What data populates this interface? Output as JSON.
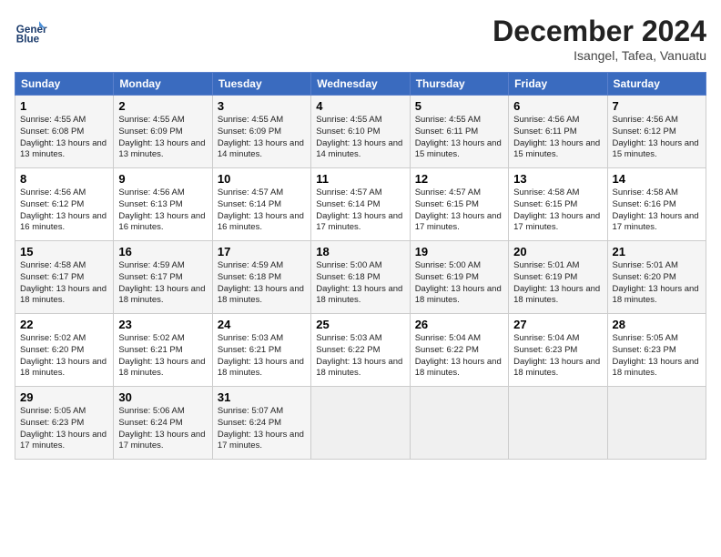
{
  "header": {
    "logo_line1": "General",
    "logo_line2": "Blue",
    "month": "December 2024",
    "location": "Isangel, Tafea, Vanuatu"
  },
  "days_of_week": [
    "Sunday",
    "Monday",
    "Tuesday",
    "Wednesday",
    "Thursday",
    "Friday",
    "Saturday"
  ],
  "weeks": [
    [
      {
        "day": 1,
        "sunrise": "4:55 AM",
        "sunset": "6:08 PM",
        "daylight": "13 hours and 13 minutes."
      },
      {
        "day": 2,
        "sunrise": "4:55 AM",
        "sunset": "6:09 PM",
        "daylight": "13 hours and 13 minutes."
      },
      {
        "day": 3,
        "sunrise": "4:55 AM",
        "sunset": "6:09 PM",
        "daylight": "13 hours and 14 minutes."
      },
      {
        "day": 4,
        "sunrise": "4:55 AM",
        "sunset": "6:10 PM",
        "daylight": "13 hours and 14 minutes."
      },
      {
        "day": 5,
        "sunrise": "4:55 AM",
        "sunset": "6:11 PM",
        "daylight": "13 hours and 15 minutes."
      },
      {
        "day": 6,
        "sunrise": "4:56 AM",
        "sunset": "6:11 PM",
        "daylight": "13 hours and 15 minutes."
      },
      {
        "day": 7,
        "sunrise": "4:56 AM",
        "sunset": "6:12 PM",
        "daylight": "13 hours and 15 minutes."
      }
    ],
    [
      {
        "day": 8,
        "sunrise": "4:56 AM",
        "sunset": "6:12 PM",
        "daylight": "13 hours and 16 minutes."
      },
      {
        "day": 9,
        "sunrise": "4:56 AM",
        "sunset": "6:13 PM",
        "daylight": "13 hours and 16 minutes."
      },
      {
        "day": 10,
        "sunrise": "4:57 AM",
        "sunset": "6:14 PM",
        "daylight": "13 hours and 16 minutes."
      },
      {
        "day": 11,
        "sunrise": "4:57 AM",
        "sunset": "6:14 PM",
        "daylight": "13 hours and 17 minutes."
      },
      {
        "day": 12,
        "sunrise": "4:57 AM",
        "sunset": "6:15 PM",
        "daylight": "13 hours and 17 minutes."
      },
      {
        "day": 13,
        "sunrise": "4:58 AM",
        "sunset": "6:15 PM",
        "daylight": "13 hours and 17 minutes."
      },
      {
        "day": 14,
        "sunrise": "4:58 AM",
        "sunset": "6:16 PM",
        "daylight": "13 hours and 17 minutes."
      }
    ],
    [
      {
        "day": 15,
        "sunrise": "4:58 AM",
        "sunset": "6:17 PM",
        "daylight": "13 hours and 18 minutes."
      },
      {
        "day": 16,
        "sunrise": "4:59 AM",
        "sunset": "6:17 PM",
        "daylight": "13 hours and 18 minutes."
      },
      {
        "day": 17,
        "sunrise": "4:59 AM",
        "sunset": "6:18 PM",
        "daylight": "13 hours and 18 minutes."
      },
      {
        "day": 18,
        "sunrise": "5:00 AM",
        "sunset": "6:18 PM",
        "daylight": "13 hours and 18 minutes."
      },
      {
        "day": 19,
        "sunrise": "5:00 AM",
        "sunset": "6:19 PM",
        "daylight": "13 hours and 18 minutes."
      },
      {
        "day": 20,
        "sunrise": "5:01 AM",
        "sunset": "6:19 PM",
        "daylight": "13 hours and 18 minutes."
      },
      {
        "day": 21,
        "sunrise": "5:01 AM",
        "sunset": "6:20 PM",
        "daylight": "13 hours and 18 minutes."
      }
    ],
    [
      {
        "day": 22,
        "sunrise": "5:02 AM",
        "sunset": "6:20 PM",
        "daylight": "13 hours and 18 minutes."
      },
      {
        "day": 23,
        "sunrise": "5:02 AM",
        "sunset": "6:21 PM",
        "daylight": "13 hours and 18 minutes."
      },
      {
        "day": 24,
        "sunrise": "5:03 AM",
        "sunset": "6:21 PM",
        "daylight": "13 hours and 18 minutes."
      },
      {
        "day": 25,
        "sunrise": "5:03 AM",
        "sunset": "6:22 PM",
        "daylight": "13 hours and 18 minutes."
      },
      {
        "day": 26,
        "sunrise": "5:04 AM",
        "sunset": "6:22 PM",
        "daylight": "13 hours and 18 minutes."
      },
      {
        "day": 27,
        "sunrise": "5:04 AM",
        "sunset": "6:23 PM",
        "daylight": "13 hours and 18 minutes."
      },
      {
        "day": 28,
        "sunrise": "5:05 AM",
        "sunset": "6:23 PM",
        "daylight": "13 hours and 18 minutes."
      }
    ],
    [
      {
        "day": 29,
        "sunrise": "5:05 AM",
        "sunset": "6:23 PM",
        "daylight": "13 hours and 17 minutes."
      },
      {
        "day": 30,
        "sunrise": "5:06 AM",
        "sunset": "6:24 PM",
        "daylight": "13 hours and 17 minutes."
      },
      {
        "day": 31,
        "sunrise": "5:07 AM",
        "sunset": "6:24 PM",
        "daylight": "13 hours and 17 minutes."
      },
      null,
      null,
      null,
      null
    ]
  ]
}
